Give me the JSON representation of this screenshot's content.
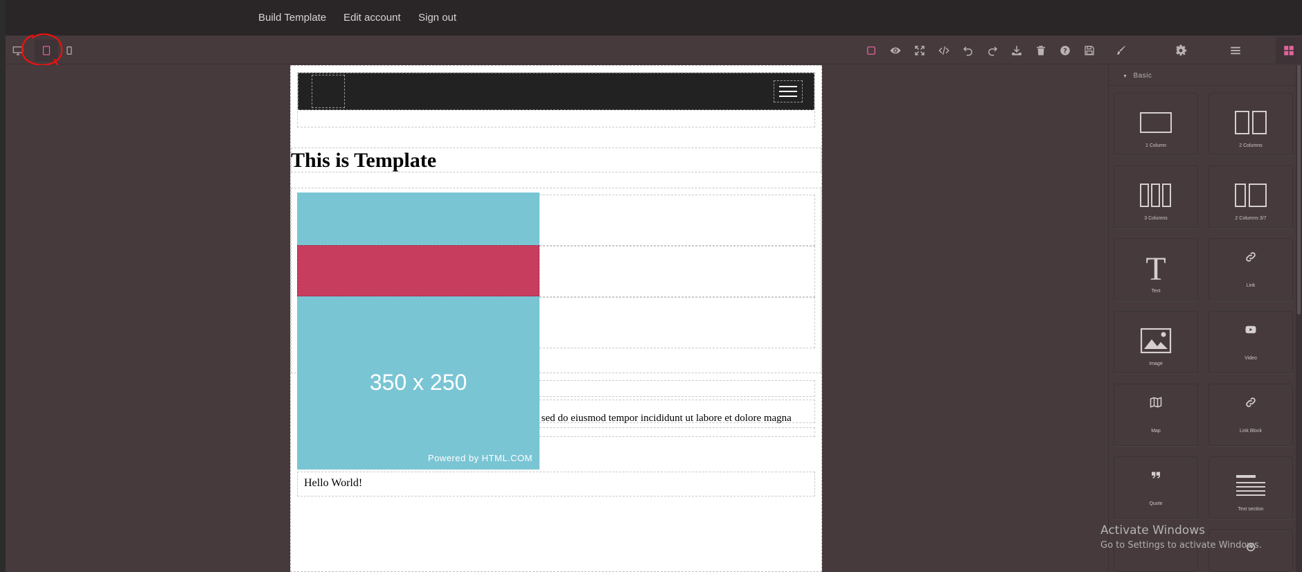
{
  "nav": {
    "build_template": "Build Template",
    "edit_account": "Edit account",
    "sign_out": "Sign out"
  },
  "toolbar": {
    "icons": [
      "square-outline-icon",
      "eye-icon",
      "fullscreen-icon",
      "code-icon",
      "undo-icon",
      "redo-icon",
      "download-icon",
      "trash-icon",
      "help-icon",
      "save-icon"
    ],
    "panel_tabs": [
      "brush-icon",
      "gear-icon",
      "layers-icon",
      "blocks-icon"
    ],
    "accent": "#e0649b"
  },
  "canvas": {
    "heading": "This is Template",
    "image_size_text": "350 x 250",
    "image_caption": "Powered by HTML.COM",
    "paragraph": "t, sed do eiusmod tempor incididunt ut labore et dolore magna",
    "hello": "Hello World!",
    "colors": {
      "teal": "#7ac5d4",
      "red": "#c73d5e",
      "navbar": "#222222"
    }
  },
  "blocks": {
    "category": "Basic",
    "items": [
      {
        "label": "1 Column",
        "icon": "one-column-icon"
      },
      {
        "label": "2 Columns",
        "icon": "two-columns-icon"
      },
      {
        "label": "3 Columns",
        "icon": "three-columns-icon"
      },
      {
        "label": "2 Columns 3/7",
        "icon": "two-columns-3-7-icon"
      },
      {
        "label": "Text",
        "icon": "text-icon"
      },
      {
        "label": "Link",
        "icon": "link-icon"
      },
      {
        "label": "Image",
        "icon": "image-icon"
      },
      {
        "label": "Video",
        "icon": "video-icon"
      },
      {
        "label": "Map",
        "icon": "map-icon"
      },
      {
        "label": "Link Block",
        "icon": "link-block-icon"
      },
      {
        "label": "Quote",
        "icon": "quote-icon"
      },
      {
        "label": "Text section",
        "icon": "text-section-icon"
      }
    ]
  },
  "watermark": {
    "line1": "Activate Windows",
    "line2": "Go to Settings to activate Windows."
  }
}
